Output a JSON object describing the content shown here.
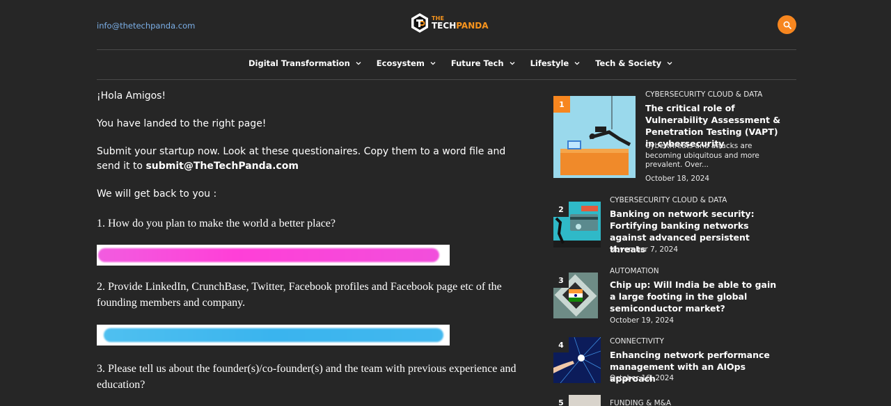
{
  "header": {
    "email": "info@thetechpanda.com",
    "logo_line1": "THE",
    "logo_tech": "TECH",
    "logo_panda": "PANDA",
    "search_icon": "search-icon"
  },
  "nav": {
    "items": [
      {
        "label": "Digital Transformation"
      },
      {
        "label": "Ecosystem"
      },
      {
        "label": "Future Tech"
      },
      {
        "label": "Lifestyle"
      },
      {
        "label": "Tech & Society"
      }
    ]
  },
  "main": {
    "greeting": "¡Hola Amigos!",
    "landed": "You have landed to the right page!",
    "submit_text": "Submit your startup now. Look at these questionaires. Copy them to a word file and send it to ",
    "submit_email": "submit@TheTechPanda.com",
    "get_back": "We will get back to you :",
    "q1": "1. How do you plan to make the world a better place?",
    "q2": "2. Provide LinkedIn, CrunchBase, Twitter, Facebook profiles and Facebook page etc of the founding members and company.",
    "q3": "3. Please tell us about the founder(s)/co-founder(s) and the team with previous experience and education?"
  },
  "colors": {
    "accent": "#f7861f",
    "background": "#262626",
    "link": "#7cb0e8",
    "highlight_pink": "#ff3fd8",
    "highlight_blue": "#3ab4ee"
  },
  "sidebar": {
    "posts": [
      {
        "rank": "1",
        "category": "CYBERSECURITY CLOUD & DATA",
        "title": "The critical role of Vulnerability Assessment & Penetration Testing (VAPT) in cybersecurity",
        "excerpt": "Cyberthreats and attacks are becoming ubiquitous and more prevalent. Over...",
        "date": "October 18, 2024"
      },
      {
        "rank": "2",
        "category": "CYBERSECURITY CLOUD & DATA",
        "title": "Banking on network security: Fortifying banking networks against advanced persistent threats",
        "date": "November 7, 2024"
      },
      {
        "rank": "3",
        "category": "AUTOMATION",
        "title": "Chip up: Will India be able to gain a large footing in the global semiconductor market?",
        "date": "October 19, 2024"
      },
      {
        "rank": "4",
        "category": "CONNECTIVITY",
        "title": "Enhancing network performance management with an AIOps approach",
        "date": "October 16, 2024"
      },
      {
        "rank": "5",
        "category": "FUNDING & M&A"
      }
    ]
  }
}
